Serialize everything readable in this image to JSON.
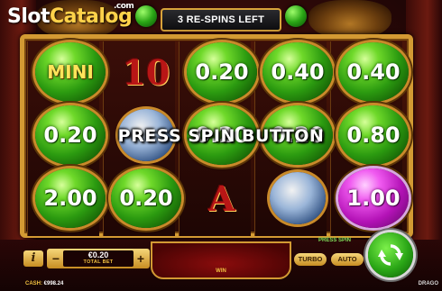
{
  "logo": {
    "slot": "Slot",
    "catalog": "Catalog",
    "com": ".com"
  },
  "respins": {
    "label": "3 RE-SPINS LEFT"
  },
  "grid": {
    "cells": [
      {
        "kind": "ball",
        "value": "MINI",
        "color": "green"
      },
      {
        "kind": "symbol",
        "value": "10"
      },
      {
        "kind": "ball",
        "value": "0.20",
        "color": "green"
      },
      {
        "kind": "ball",
        "value": "0.40",
        "color": "green"
      },
      {
        "kind": "ball",
        "value": "0.40",
        "color": "green"
      },
      {
        "kind": "ball",
        "value": "0.20",
        "color": "green"
      },
      {
        "kind": "symbol-circle",
        "value": ""
      },
      {
        "kind": "ball",
        "value": "0.20",
        "color": "green"
      },
      {
        "kind": "ball",
        "value": "0.20",
        "color": "green"
      },
      {
        "kind": "ball",
        "value": "0.80",
        "color": "green"
      },
      {
        "kind": "ball",
        "value": "2.00",
        "color": "green"
      },
      {
        "kind": "ball",
        "value": "0.20",
        "color": "green"
      },
      {
        "kind": "symbol",
        "value": "A"
      },
      {
        "kind": "symbol-circle",
        "value": ""
      },
      {
        "kind": "ball",
        "value": "1.00",
        "color": "pink"
      }
    ]
  },
  "overlay": {
    "message": "PRESS SPIN BUTTON"
  },
  "controls": {
    "info_label": "i",
    "minus_label": "−",
    "plus_label": "+",
    "bet_value": "€0.20",
    "bet_label": "TOTAL BET",
    "win_label": "WIN",
    "press_spin_label": "PRESS SPIN",
    "turbo_label": "TURBO",
    "auto_label": "AUTO",
    "spin_icon": "refresh-arrows-icon"
  },
  "footer": {
    "cash_label": "CASH:",
    "cash_value": "€998.24",
    "brand": "DRAGO"
  },
  "colors": {
    "frame_gold": "#d39a33",
    "ball_green": "#2b9a10",
    "ball_pink": "#b312b6",
    "accent_yellow": "#f0c040"
  }
}
